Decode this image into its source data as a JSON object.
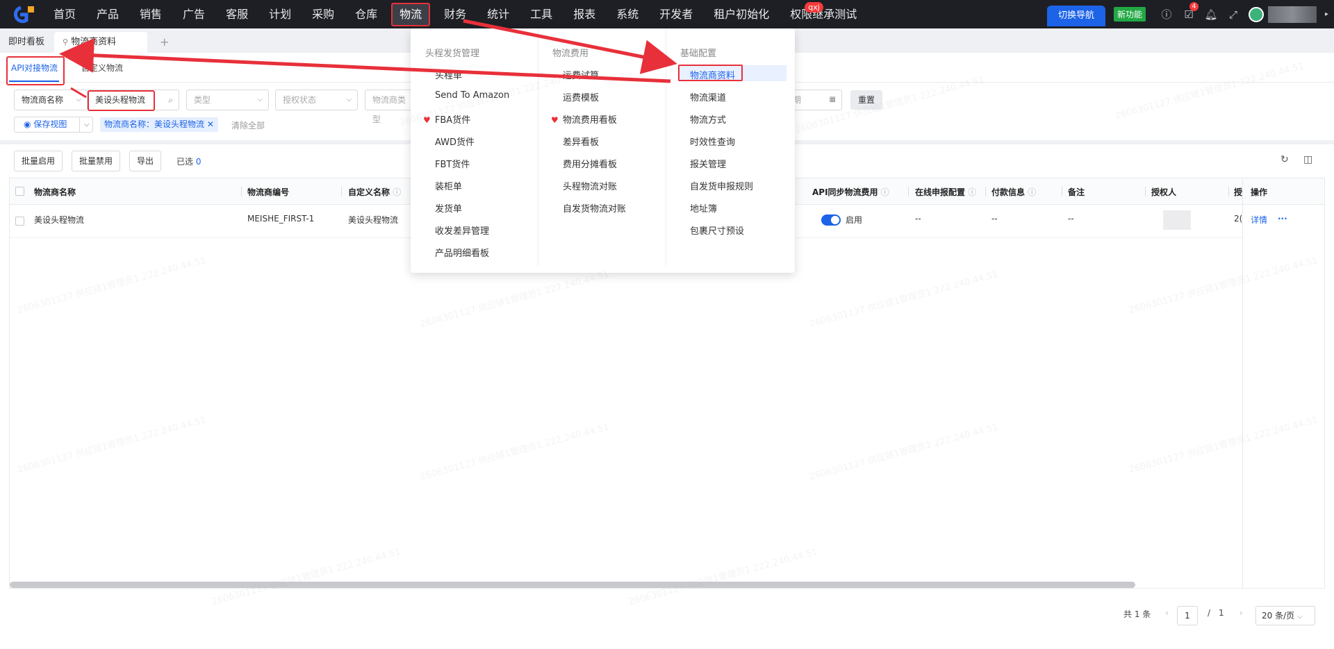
{
  "nav": {
    "menu": [
      "首页",
      "产品",
      "销售",
      "广告",
      "客服",
      "计划",
      "采购",
      "仓库",
      "物流",
      "财务",
      "统计",
      "工具",
      "报表",
      "系统",
      "开发者",
      "租户初始化",
      "权限继承测试"
    ],
    "active_menu": "物流",
    "badge_qxj": "qxj",
    "switch_nav": "切换导航",
    "new_feature": "新功能",
    "task_badge": "4"
  },
  "tabs": {
    "dashboard": "即时看板",
    "current": "物流商资料",
    "add": "+"
  },
  "subtabs": {
    "api": "API对接物流",
    "custom": "自定义物流"
  },
  "filters": {
    "name_select": "物流商名称",
    "name_value": "美设头程物流",
    "type_placeholder": "类型",
    "auth_placeholder": "授权状态",
    "category_placeholder": "物流商类型",
    "date_placeholder": "期",
    "reset": "重置",
    "save_view": "保存视图",
    "chip": "物流商名称：美设头程物流",
    "clear_all": "清除全部"
  },
  "actions": {
    "enable": "批量启用",
    "disable": "批量禁用",
    "export": "导出",
    "selected_label": "已选",
    "selected_count": "0"
  },
  "table": {
    "headers": {
      "name": "物流商名称",
      "code": "物流商编号",
      "custom_name": "自定义名称",
      "api_sync": "API同步物流费用",
      "online": "在线申报配置",
      "payment": "付款信息",
      "remark": "备注",
      "authorizer": "授权人",
      "last": "授",
      "ops": "操作"
    },
    "row": {
      "name": "美设头程物流",
      "code": "MEISHE_FIRST-1",
      "custom_name": "美设头程物流",
      "api_sync": "启用",
      "online": "--",
      "payment": "--",
      "remark": "--",
      "last": "2(",
      "detail": "详情",
      "more": "···"
    }
  },
  "pager": {
    "total": "共 1 条",
    "page": "1",
    "sep": "/",
    "pages": "1",
    "size": "20 条/页"
  },
  "dropdown": {
    "col1": {
      "title": "头程发货管理",
      "items": [
        "头程单",
        "Send To Amazon",
        "FBA货件",
        "AWD货件",
        "FBT货件",
        "装柜单",
        "发货单",
        "收发差异管理",
        "产品明细看板"
      ]
    },
    "col2": {
      "title": "物流费用",
      "items": [
        "运费试算",
        "运费模板",
        "物流费用看板",
        "差异看板",
        "费用分摊看板",
        "头程物流对账",
        "自发货物流对账"
      ]
    },
    "col3": {
      "title": "基础配置",
      "items": [
        "物流商资料",
        "物流渠道",
        "物流方式",
        "时效性查询",
        "报关管理",
        "自发货申报规则",
        "地址簿",
        "包裹尺寸预设"
      ]
    }
  },
  "watermark": "2606301127 供应链1管理员1 222.240.44.51"
}
